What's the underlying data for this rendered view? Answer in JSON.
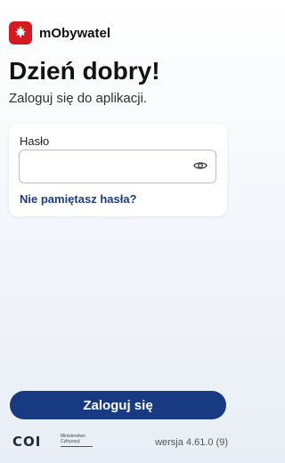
{
  "header": {
    "app_name": "mObywatel"
  },
  "welcome": {
    "title": "Dzień dobry!",
    "subtitle": "Zaloguj się do aplikacji."
  },
  "login_form": {
    "password_label": "Hasło",
    "password_value": "",
    "forgot_password": "Nie pamiętasz hasła?"
  },
  "actions": {
    "login_button": "Zaloguj się"
  },
  "footer": {
    "coi_logo": "COI",
    "ministry_line1": "Ministerstwo",
    "ministry_line2": "Cyfryzacji",
    "version": "wersja 4.61.0 (9)"
  },
  "icons": {
    "logo": "polish-eagle-icon",
    "password_toggle": "eye-icon"
  },
  "colors": {
    "brand_red": "#d71a21",
    "primary_blue": "#173a83",
    "link_blue": "#1c3a8a"
  }
}
